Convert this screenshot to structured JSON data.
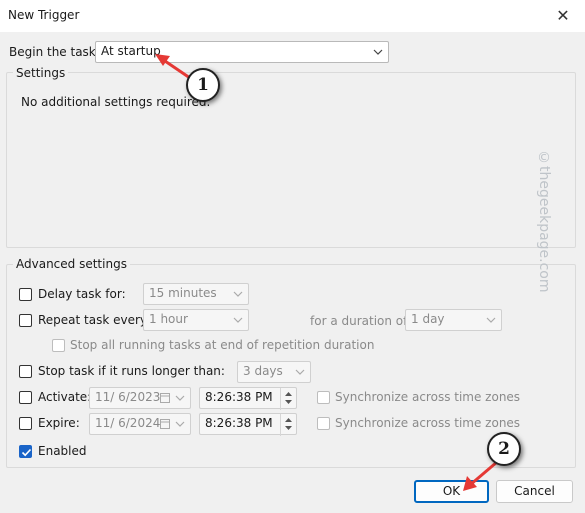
{
  "dialog": {
    "title": "New Trigger",
    "close_icon": "close-icon",
    "begin_label": "Begin the task:",
    "begin_value": "At startup"
  },
  "settings": {
    "group_label": "Settings",
    "message": "No additional settings required."
  },
  "advanced": {
    "group_label": "Advanced settings",
    "delay": {
      "label": "Delay task for:",
      "value": "15 minutes",
      "checked": false
    },
    "repeat": {
      "label": "Repeat task every:",
      "value": "1 hour",
      "checked": false,
      "duration_label": "for a duration of:",
      "duration_value": "1 day"
    },
    "stop_running": {
      "label": "Stop all running tasks at end of repetition duration",
      "checked": false
    },
    "stop_longer": {
      "label": "Stop task if it runs longer than:",
      "value": "3 days",
      "checked": false
    },
    "activate": {
      "label": "Activate:",
      "date": "11/ 6/2023",
      "time": "8:26:38 PM",
      "sync_label": "Synchronize across time zones",
      "checked": false
    },
    "expire": {
      "label": "Expire:",
      "date": "11/ 6/2024",
      "time": "8:26:38 PM",
      "sync_label": "Synchronize across time zones",
      "checked": false
    },
    "enabled": {
      "label": "Enabled",
      "checked": true
    }
  },
  "buttons": {
    "ok": "OK",
    "cancel": "Cancel"
  },
  "annotations": {
    "step1": "1",
    "step2": "2",
    "arrow_color": "#e53935"
  },
  "watermark": "©thegeekpage.com",
  "colors": {
    "accent": "#0067c0",
    "checkbox": "#1a64c8",
    "arrow": "#e53935"
  }
}
